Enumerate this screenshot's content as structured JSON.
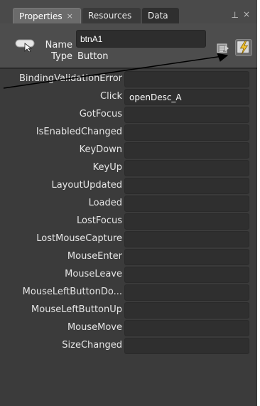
{
  "tabs": [
    {
      "label": "Properties",
      "close": "×"
    },
    {
      "label": "Resources"
    },
    {
      "label": "Data"
    }
  ],
  "window_controls": {
    "pin": "⊥",
    "close": "×"
  },
  "header": {
    "name_label": "Name",
    "name_value": "btnA1",
    "type_label": "Type",
    "type_value": "Button",
    "icons": {
      "control": "button-control-icon",
      "properties": "properties-view-icon",
      "events": "events-lightning-icon"
    }
  },
  "events": [
    {
      "name": "BindingValidationError",
      "value": ""
    },
    {
      "name": "Click",
      "value": "openDesc_A"
    },
    {
      "name": "GotFocus",
      "value": ""
    },
    {
      "name": "IsEnabledChanged",
      "value": ""
    },
    {
      "name": "KeyDown",
      "value": ""
    },
    {
      "name": "KeyUp",
      "value": ""
    },
    {
      "name": "LayoutUpdated",
      "value": ""
    },
    {
      "name": "Loaded",
      "value": ""
    },
    {
      "name": "LostFocus",
      "value": ""
    },
    {
      "name": "LostMouseCapture",
      "value": ""
    },
    {
      "name": "MouseEnter",
      "value": ""
    },
    {
      "name": "MouseLeave",
      "value": ""
    },
    {
      "name": "MouseLeftButtonDo...",
      "value": ""
    },
    {
      "name": "MouseLeftButtonUp",
      "value": ""
    },
    {
      "name": "MouseMove",
      "value": ""
    },
    {
      "name": "SizeChanged",
      "value": ""
    }
  ],
  "colors": {
    "panel": "#3b3b3b",
    "field": "#2f2f2f",
    "accent_lightning": "#f2c230"
  }
}
